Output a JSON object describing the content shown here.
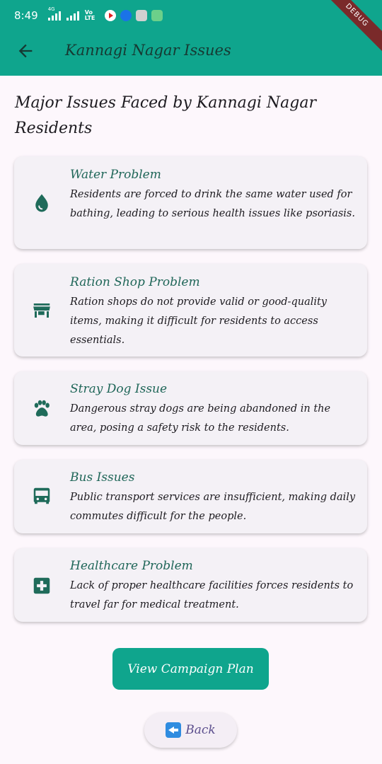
{
  "status_bar": {
    "time": "8:49",
    "network_tag": "4G",
    "volte": "Vo LTE",
    "debug_banner": "DEBUG"
  },
  "app_bar": {
    "title": "Kannagi Nagar Issues",
    "back_icon": "arrow-left-icon"
  },
  "page": {
    "heading": "Major Issues Faced by Kannagi Nagar Residents"
  },
  "issues": [
    {
      "icon": "water-drop-icon",
      "title": "Water Problem",
      "description": "Residents are forced to drink the same water used for bathing, leading to serious health issues like psoriasis."
    },
    {
      "icon": "storefront-icon",
      "title": "Ration Shop Problem",
      "description": "Ration shops do not provide valid or good-quality items, making it difficult for residents to access essentials."
    },
    {
      "icon": "paw-icon",
      "title": "Stray Dog Issue",
      "description": "Dangerous stray dogs are being abandoned in the area, posing a safety risk to the residents."
    },
    {
      "icon": "bus-icon",
      "title": "Bus Issues",
      "description": "Public transport services are insufficient, making daily commutes difficult for the people."
    },
    {
      "icon": "medical-cross-icon",
      "title": "Healthcare Problem",
      "description": "Lack of proper healthcare facilities forces residents to travel far for medical treatment."
    }
  ],
  "actions": {
    "campaign_label": "View Campaign Plan",
    "back_label": "Back"
  },
  "colors": {
    "primary": "#0fa58d",
    "icon": "#1f6b5a",
    "card_bg": "#f4f1f6",
    "page_bg": "#fdf7fc"
  }
}
